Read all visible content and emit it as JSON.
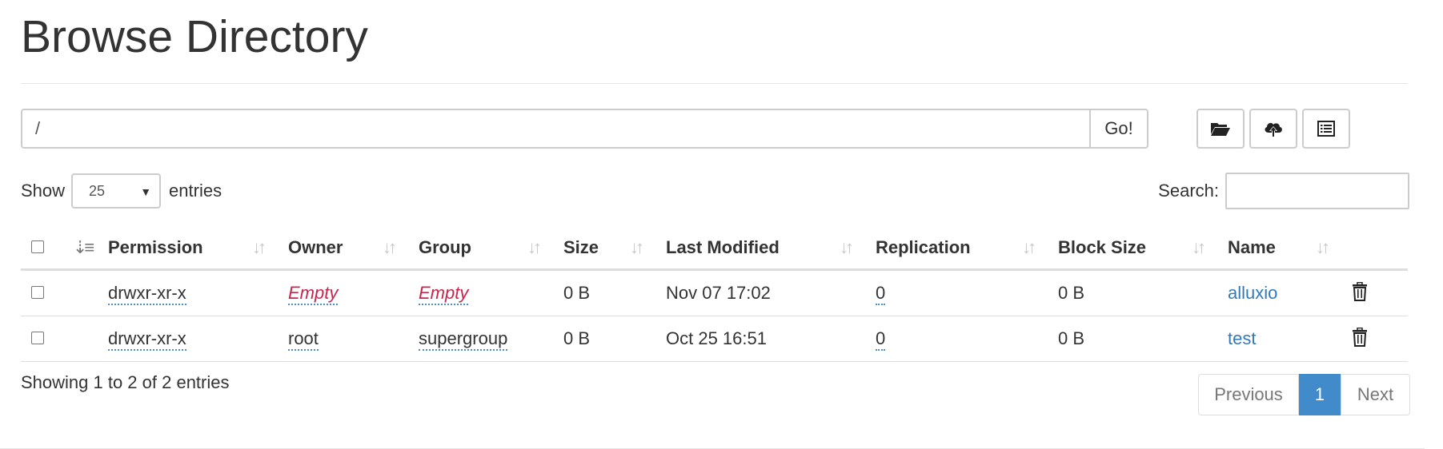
{
  "page": {
    "title": "Browse Directory"
  },
  "path_bar": {
    "value": "/",
    "go_label": "Go!"
  },
  "toolbar": {
    "icons": [
      "folder-open-icon",
      "cloud-upload-icon",
      "list-alt-icon"
    ]
  },
  "length_menu": {
    "prefix": "Show",
    "value": "25",
    "suffix": "entries"
  },
  "search": {
    "label": "Search:",
    "value": ""
  },
  "table": {
    "columns": [
      "Permission",
      "Owner",
      "Group",
      "Size",
      "Last Modified",
      "Replication",
      "Block Size",
      "Name"
    ],
    "rows": [
      {
        "permission": "drwxr-xr-x",
        "owner": "Empty",
        "group": "Empty",
        "size": "0 B",
        "last_modified": "Nov 07 17:02",
        "replication": "0",
        "block_size": "0 B",
        "name": "alluxio"
      },
      {
        "permission": "drwxr-xr-x",
        "owner": "root",
        "group": "supergroup",
        "size": "0 B",
        "last_modified": "Oct 25 16:51",
        "replication": "0",
        "block_size": "0 B",
        "name": "test"
      }
    ]
  },
  "info": "Showing 1 to 2 of 2 entries",
  "pagination": {
    "previous": "Previous",
    "current": "1",
    "next": "Next"
  },
  "colors": {
    "link": "#337ab7",
    "empty": "#c7254e",
    "active_page": "#428bca"
  }
}
